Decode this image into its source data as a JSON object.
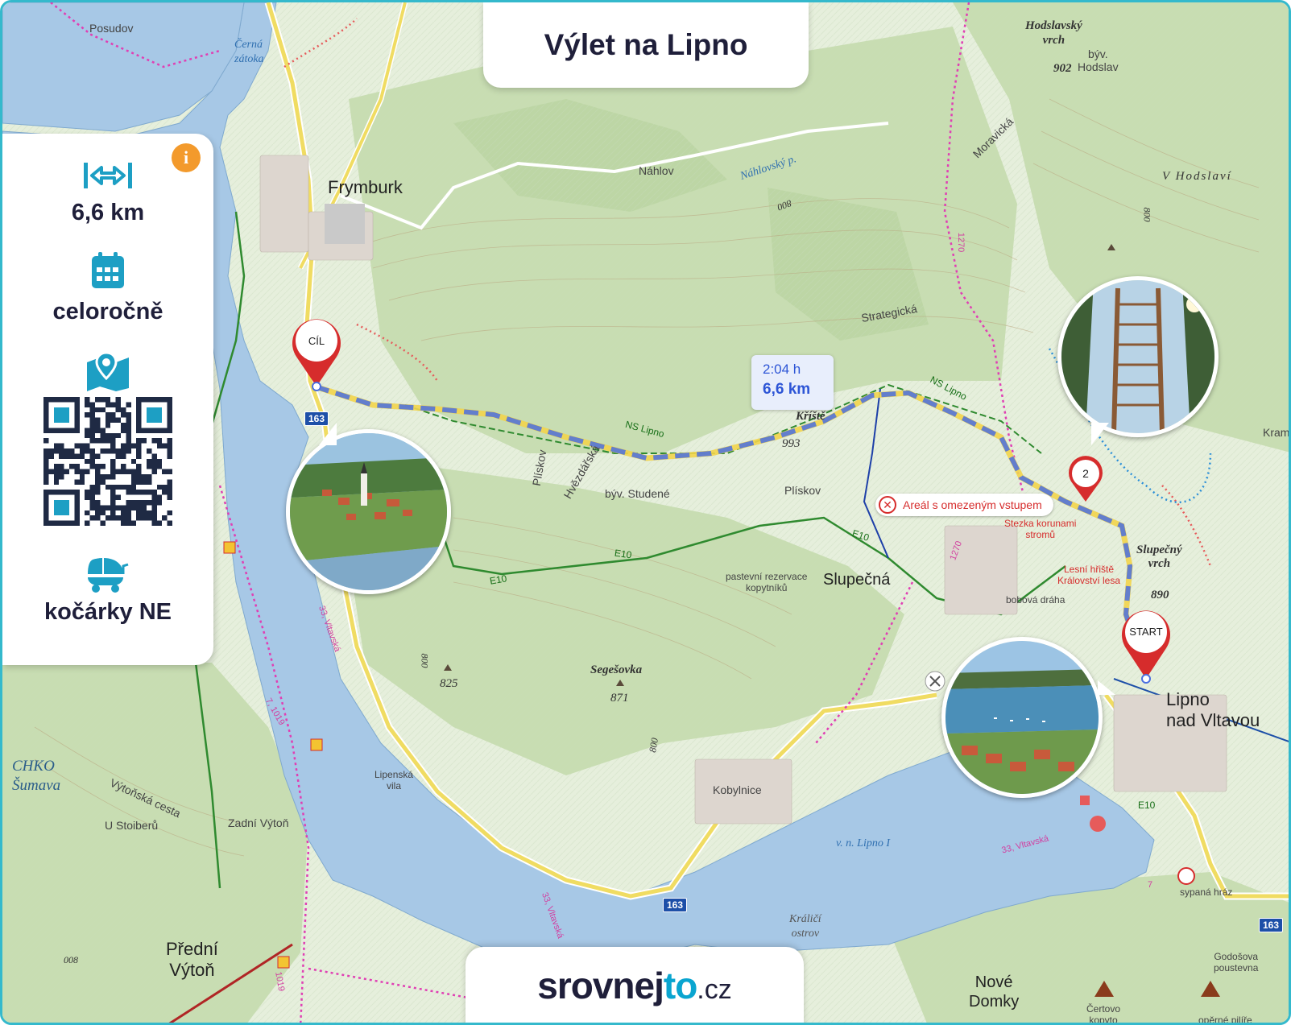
{
  "title": "Výlet na Lipno",
  "sidebar": {
    "distance": "6,6 km",
    "season": "celoročně",
    "stroller": "kočárky NE",
    "icons": [
      "distance-arrows-icon",
      "calendar-icon",
      "map-pin-icon",
      "qr-code",
      "stroller-icon",
      "info-icon"
    ],
    "info": "i",
    "accent": "#1d9fc4"
  },
  "route": {
    "time": "2:04 h",
    "distance": "6,6 km",
    "color": "#4a6fe0",
    "start_label": "START",
    "end_label": "CÍL",
    "waypoint": "2"
  },
  "restricted_badge": "Areál s omezeným vstupem",
  "map_labels": {
    "posudov": "Posudov",
    "cerna_zatoka": "Černá\nzátoka",
    "frymburk": "Frymburk",
    "nahlov": "Náhlov",
    "nahlovsky": "Náhlovský p.",
    "hodslavsky": "Hodslavský\nvrch",
    "byv_hodslav": "býv.\nHodslav",
    "h902": "902",
    "moravicka": "Moravická",
    "v_hodslavi": "V Hodslaví",
    "strategicka": "Strategická",
    "ns_lipno_1": "NS Lipno",
    "ns_lipno_2": "NS Lipno",
    "kristal": "Kříště",
    "h993": "993",
    "byv_studene": "býv. Studené",
    "pliskov_1": "Plískov",
    "pliskov_2": "Plískov",
    "hvezdarska": "Hvězdářská",
    "e10_1": "E10",
    "e10_2": "E10",
    "e10_3": "E10",
    "e10_4": "E10",
    "pastevni": "pastevní rezervace\nkopytníků",
    "slupecna": "Slupečná",
    "stezka": "Stezka korunami\nstromů",
    "slupecny_vrch": "Slupečný\nvrch",
    "lesni_hriste": "Lesní hřiště\nKrálovství lesa",
    "bobova": "bobová dráha",
    "h890": "890",
    "segesovka": "Segešovka",
    "h871": "871",
    "h825": "825",
    "h800_1": "800",
    "h800_2": "800",
    "h800_3": "800",
    "h800_4": "800",
    "lipno": "Lipno\nnad Vltavou",
    "kramolin": "Kramo",
    "kobylnice": "Kobylnice",
    "lipenska_vila": "Lipenská\nvila",
    "vn_lipno": "v. n. Lipno I",
    "kralici": "Králičí\nostrov",
    "vltavska_1": "33, Vltavská",
    "vltavska_2": "33, Vltavská",
    "vltavska_3": "33, Vltavská",
    "chko": "CHKO\nŠumava",
    "vytonska": "Výtoňská cesta",
    "u_stoiberu": "U Stoiberů",
    "zadni_vyton": "Zadní Výtoň",
    "predni_vyton": "Přední\nVýtoň",
    "h008": "008",
    "r7_1019": "7, 1019",
    "r1019": "1019",
    "r1270_1": "1270",
    "r1270_2": "1270",
    "nove_domky": "Nové\nDomky",
    "sypana_hraz": "sypaná hráz",
    "godosova": "Godošova\npoustevna",
    "certovo": "Čertovo\nkopyto",
    "operne": "opěrné pilíře",
    "r7": "7",
    "road163_a": "163",
    "road163_b": "163",
    "road163_c": "163"
  },
  "brand": {
    "part1": "srovnej",
    "part2": "to",
    "part3": ".cz"
  }
}
